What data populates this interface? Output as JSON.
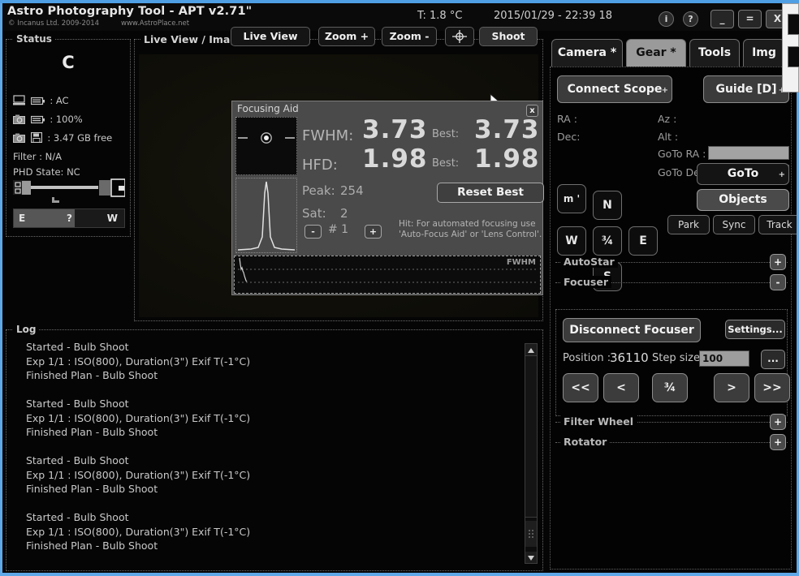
{
  "titlebar": {
    "app_title": "Astro Photography Tool - APT v2.71\"",
    "copyright": "© Incanus Ltd. 2009-2014",
    "website": "www.AstroPlace.net",
    "temperature": "T: 1.8 °C",
    "datetime": "2015/01/29 - 22:39 18",
    "info_label": "i",
    "help_label": "?",
    "minimize_label": "_",
    "maximize_label": "=",
    "close_label": "X"
  },
  "status": {
    "title": "Status",
    "state": "C",
    "power_source": ": AC",
    "battery": ": 100%",
    "storage": ": 3.47 GB free",
    "filter": "Filter : N/A",
    "phd_state": "PHD State: NC",
    "east_label": "E",
    "unknown_label": "?",
    "west_label": "W"
  },
  "liveview": {
    "title": "Live View / Imag",
    "btn_liveview": "Live View",
    "btn_zoom_in": "Zoom +",
    "btn_zoom_out": "Zoom -",
    "btn_center": "",
    "btn_shoot": "Shoot"
  },
  "focusing_aid": {
    "title": "Focusing Aid",
    "close_label": "x",
    "fwhm_label": "FWHM:",
    "fwhm_value": "3.73",
    "fwhm_best_label": "Best:",
    "fwhm_best_value": "3.73",
    "hfd_label": "HFD:",
    "hfd_value": "1.98",
    "hfd_best_label": "Best:",
    "hfd_best_value": "1.98",
    "peak_label": "Peak:",
    "peak_value": "254",
    "sat_label": "Sat:",
    "sat_value": "2",
    "reset_best_label": "Reset Best",
    "minus_label": "-",
    "plus_label": "+",
    "star_index_label": "#  1",
    "hint": "Hit: For automated focusing use 'Auto-Focus Aid' or 'Lens Control'.",
    "trend_label": "FWHM"
  },
  "log": {
    "title": "Log",
    "lines": "  Started - Bulb Shoot\n  Exp 1/1 : ISO(800), Duration(3\") Exif T(-1°C)\n  Finished Plan - Bulb Shoot\n\n  Started - Bulb Shoot\n  Exp 1/1 : ISO(800), Duration(3\") Exif T(-1°C)\n  Finished Plan - Bulb Shoot\n\n  Started - Bulb Shoot\n  Exp 1/1 : ISO(800), Duration(3\") Exif T(-1°C)\n  Finished Plan - Bulb Shoot\n\n  Started - Bulb Shoot\n  Exp 1/1 : ISO(800), Duration(3\") Exif T(-1°C)\n  Finished Plan - Bulb Shoot"
  },
  "right_panel": {
    "tabs": [
      {
        "label": "Camera *",
        "active": false
      },
      {
        "label": "Gear *",
        "active": true
      },
      {
        "label": "Tools",
        "active": false
      },
      {
        "label": "Img",
        "active": false
      }
    ],
    "connect_scope_label": "Connect Scope",
    "guide_label": "Guide [D]",
    "plus_mark": "+",
    "ra_label": "RA :",
    "dec_label": "Dec:",
    "az_label": "Az :",
    "alt_label": "Alt :",
    "goto_ra_label": "GoTo RA  :",
    "goto_dec_label": "GoTo Dec:",
    "goto_ra_value": "",
    "goto_dec_value": "",
    "rate_label": "m '",
    "north_label": "N",
    "west_label": "W",
    "center_label": "¾",
    "east_label": "E",
    "south_label": "S",
    "goto_button_label": "GoTo",
    "objects_button_label": "Objects",
    "park_label": "Park",
    "sync_label": "Sync",
    "track_label": "Track",
    "sections": {
      "autostar": {
        "title": "AutoStar",
        "toggle": "+"
      },
      "focuser": {
        "title": "Focuser",
        "toggle": "-"
      },
      "filter_wheel": {
        "title": "Filter Wheel",
        "toggle": "+"
      },
      "rotator": {
        "title": "Rotator",
        "toggle": "+"
      }
    },
    "focuser": {
      "disconnect_label": "Disconnect Focuser",
      "settings_label": "Settings...",
      "position_label": "Position :",
      "position_value": "36110",
      "step_size_label": "Step size:",
      "step_size_value": "100",
      "dots_label": "...",
      "far_out_label": "<<",
      "out_label": "<",
      "stop_label": "¾",
      "in_label": ">",
      "far_in_label": ">>"
    }
  },
  "colors": {
    "window_border": "#5fa8e8",
    "panel_bg": "#050505",
    "dialog_bg": "#4a4a4a",
    "text": "#d8d8d8",
    "muted_text": "#9e9e9e",
    "field_bg": "#a3a3a3"
  }
}
